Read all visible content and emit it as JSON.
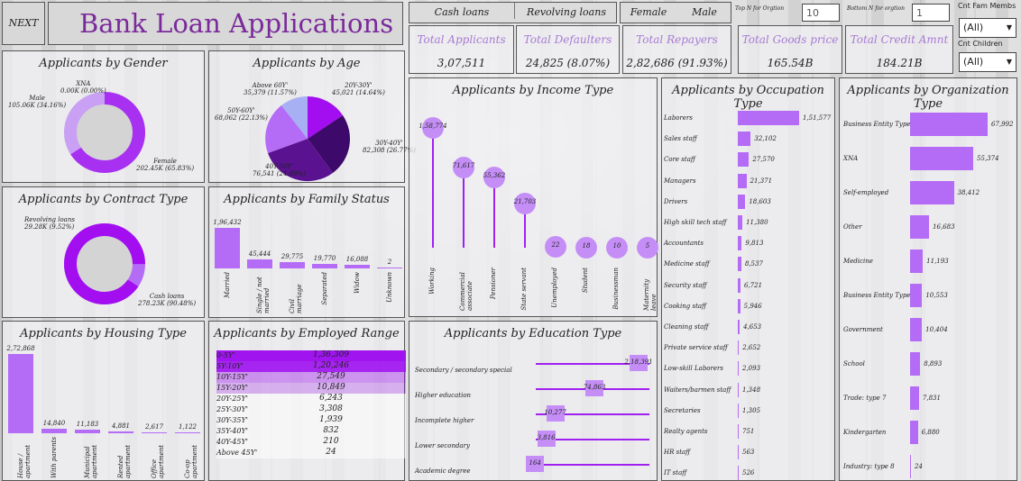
{
  "header": {
    "next": "NEXT",
    "title": "Bank Loan Applications"
  },
  "filters": {
    "contract": [
      "Cash loans",
      "Revolving loans"
    ],
    "gender": [
      "Female",
      "Male"
    ],
    "topn_label": "Top N for Orgtion",
    "topn_value": "10",
    "bottomn_label": "Bottom N for orgtion",
    "bottomn_value": "1",
    "famm_label": "Cnt Fam Membs",
    "famm_value": "(All)",
    "child_label": "Cnt Children",
    "child_value": "(All)"
  },
  "kpis": [
    {
      "label": "Total Applicants",
      "value": "3,07,511"
    },
    {
      "label": "Total Defaulters",
      "value": "24,825 (8.07%)"
    },
    {
      "label": "Total  Repayers",
      "value": "2,82,686 (91.93%)"
    },
    {
      "label": "Total Goods price",
      "value": "165.54B"
    },
    {
      "label": "Total Credit Amnt",
      "value": "184.21B"
    }
  ],
  "colors": {
    "accent": "#b46cf6",
    "dark": "#3d0a6b",
    "title": "#7a2a9a"
  },
  "gender": {
    "title": "Applicants by Gender",
    "xna": "XNA\n0.00K (0.00%)",
    "male": "Male\n105.06K (34.16%)",
    "female": "Female\n202.45K (65.83%)",
    "female_share": 65.83
  },
  "contract": {
    "title": "Applicants by Contract Type",
    "rev": "Revolving loans\n29.28K (9.52%)",
    "cash": "Cash loans\n278.23K (90.48%)",
    "cash_share": 90.48
  },
  "age": {
    "title": "Applicants by Age",
    "labels": [
      "Above 60Y'\n35,379 (11.57%)",
      "20Y-30Y'\n45,021 (14.64%)",
      "30Y-40Y'\n82,308 (26.77%)",
      "40Y-50Y'\n76,541 (24.89%)",
      "50Y-60Y'\n68,062 (22.13%)"
    ]
  },
  "chart_data": [
    {
      "type": "bar",
      "title": "Applicants by Family Status",
      "categories": [
        "Married",
        "Single / not married",
        "Civil marriage",
        "Separated",
        "Widow",
        "Unknown"
      ],
      "values": [
        196432,
        45444,
        29775,
        19770,
        16088,
        2
      ],
      "value_labels": [
        "1,96,432",
        "45,444",
        "29,775",
        "19,770",
        "16,088",
        "2"
      ]
    },
    {
      "type": "bar",
      "title": "Applicants by Housing Type",
      "categories": [
        "House / apartment",
        "With parents",
        "Municipal apartment",
        "Rented apartment",
        "Office apartment",
        "Co-op apartment"
      ],
      "values": [
        272868,
        14840,
        11183,
        4881,
        2617,
        1122
      ],
      "value_labels": [
        "2,72,868",
        "14,840",
        "11,183",
        "4,881",
        "2,617",
        "1,122"
      ]
    },
    {
      "type": "scatter",
      "title": "Applicants by Income Type",
      "categories": [
        "Working",
        "Commercial associate",
        "Pensioner",
        "State servant",
        "Unemployed",
        "Student",
        "Businessman",
        "Maternity leave"
      ],
      "values": [
        158774,
        71617,
        55362,
        21703,
        22,
        18,
        10,
        5
      ],
      "value_labels": [
        "1,58,774",
        "71,617",
        "55,362",
        "21,703",
        "22",
        "18",
        "10",
        "5"
      ]
    },
    {
      "type": "bar",
      "title": "Applicants by Occupation Type",
      "categories": [
        "Laborers",
        "Sales staff",
        "Core staff",
        "Managers",
        "Drivers",
        "High skill tech staff",
        "Accountants",
        "Medicine staff",
        "Security staff",
        "Cooking staff",
        "Cleaning staff",
        "Private service staff",
        "Low-skill Laborers",
        "Waiters/barmen staff",
        "Secretaries",
        "Realty agents",
        "HR staff",
        "IT staff"
      ],
      "values": [
        151577,
        32102,
        27570,
        21371,
        18603,
        11380,
        9813,
        8537,
        6721,
        5946,
        4653,
        2652,
        2093,
        1348,
        1305,
        751,
        563,
        526
      ],
      "value_labels": [
        "1,51,577",
        "32,102",
        "27,570",
        "21,371",
        "18,603",
        "11,380",
        "9,813",
        "8,537",
        "6,721",
        "5,946",
        "4,653",
        "2,652",
        "2,093",
        "1,348",
        "1,305",
        "751",
        "563",
        "526"
      ]
    },
    {
      "type": "bar",
      "title": "Applicants by Organization Type",
      "categories": [
        "Business Entity Type 3",
        "XNA",
        "Self-employed",
        "Other",
        "Medicine",
        "Business Entity Type 2",
        "Government",
        "School",
        "Trade: type 7",
        "Kindergarten",
        "Industry: type 8"
      ],
      "values": [
        67992,
        55374,
        38412,
        16683,
        11193,
        10553,
        10404,
        8893,
        7831,
        6880,
        24
      ],
      "value_labels": [
        "67,992",
        "55,374",
        "38,412",
        "16,683",
        "11,193",
        "10,553",
        "10,404",
        "8,893",
        "7,831",
        "6,880",
        "24"
      ]
    },
    {
      "type": "scatter",
      "title": "Applicants by Education Type",
      "categories": [
        "Secondary / secondary special",
        "Higher education",
        "Incomplete higher",
        "Lower secondary",
        "Academic degree"
      ],
      "values": [
        218391,
        74863,
        10277,
        3816,
        164
      ],
      "value_labels": [
        "2,18,391",
        "74,863",
        "10,277",
        "3,816",
        "164"
      ]
    },
    {
      "type": "table",
      "title": "Applicants by Employed Range",
      "categories": [
        "0-5Y'",
        "5Y-10Y'",
        "10Y-15Y'",
        "15Y-20Y'",
        "20Y-25Y'",
        "25Y-30Y'",
        "30Y-35Y'",
        "35Y-40Y'",
        "40Y-45Y'",
        "Above 45Y'"
      ],
      "values": [
        136309,
        120246,
        27549,
        10849,
        6243,
        3308,
        1939,
        832,
        210,
        24
      ],
      "value_labels": [
        "1,36,309",
        "1,20,246",
        "27,549",
        "10,849",
        "6,243",
        "3,308",
        "1,939",
        "832",
        "210",
        "24"
      ]
    }
  ]
}
